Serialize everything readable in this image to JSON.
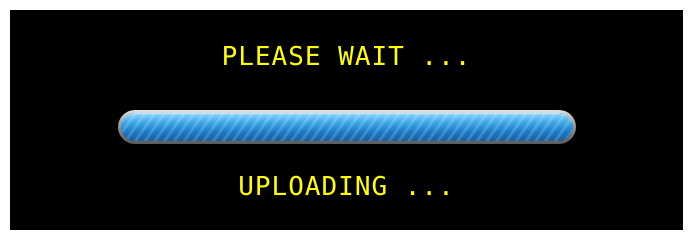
{
  "dialog": {
    "top_message": "PLEASE WAIT ...",
    "bottom_message": "UPLOADING ...",
    "progress": 1.0
  },
  "colors": {
    "background": "#000000",
    "text": "#ffff00",
    "progress_fill": "#2f95dd"
  }
}
